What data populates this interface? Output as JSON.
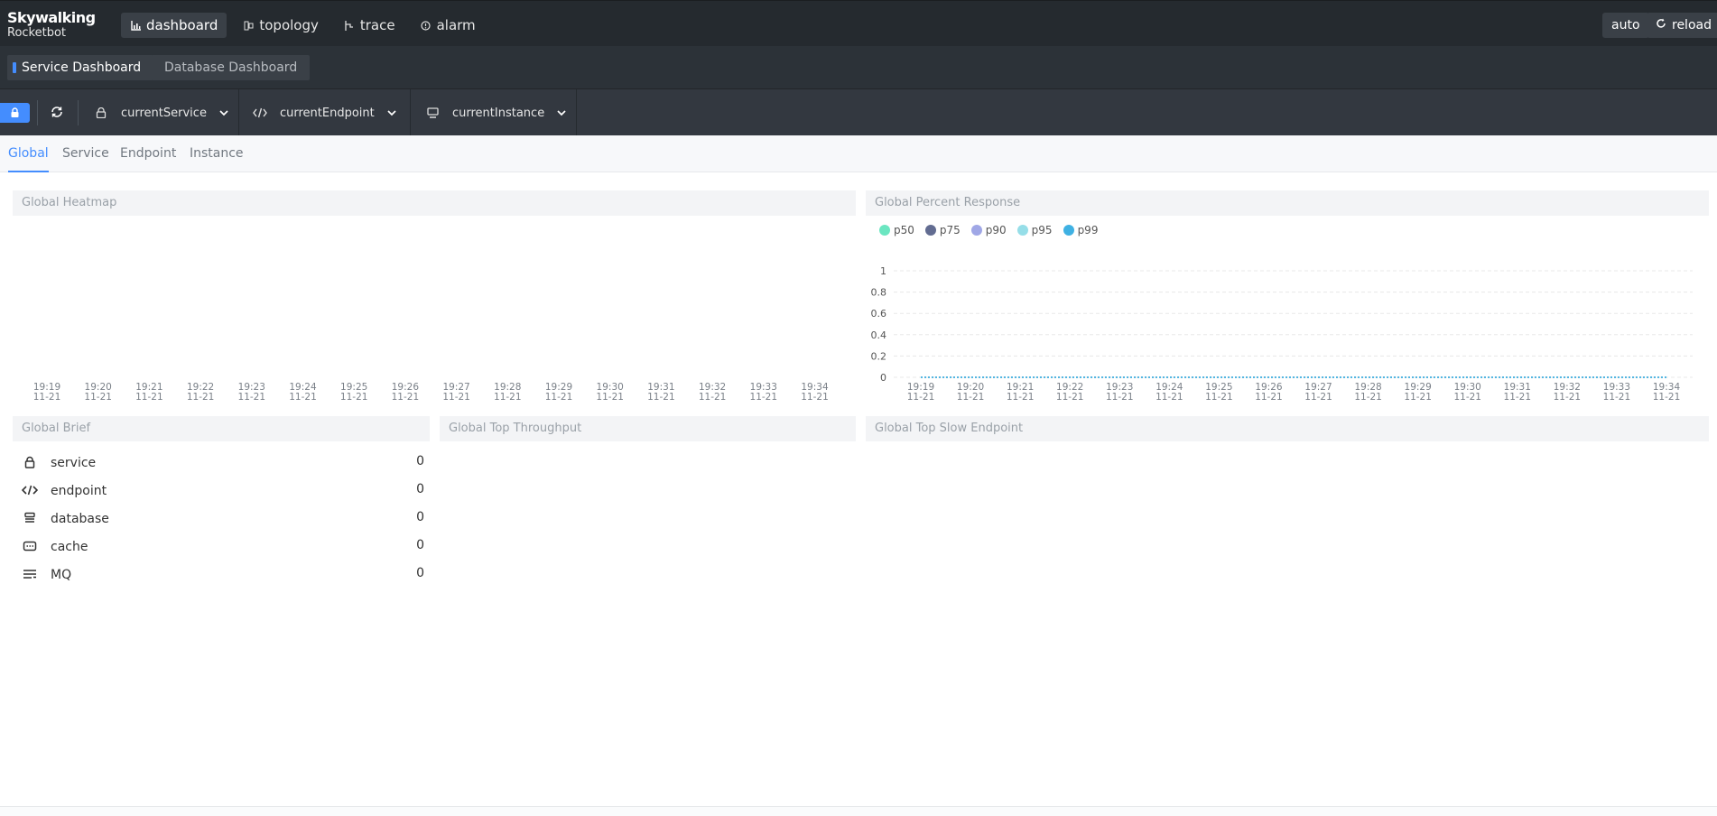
{
  "logo": {
    "line1": "Skywalking",
    "line2": "Rocketbot"
  },
  "nav": {
    "items": [
      {
        "label": "dashboard",
        "icon": "chart-icon",
        "active": true
      },
      {
        "label": "topology",
        "icon": "topology-icon",
        "active": false
      },
      {
        "label": "trace",
        "icon": "trace-icon",
        "active": false
      },
      {
        "label": "alarm",
        "icon": "alarm-icon",
        "active": false
      }
    ],
    "auto_label": "auto",
    "reload_label": "reload"
  },
  "dashboards": [
    {
      "label": "Service Dashboard",
      "active": true
    },
    {
      "label": "Database Dashboard",
      "active": false
    }
  ],
  "toolbar": {
    "service": "currentService",
    "endpoint": "currentEndpoint",
    "instance": "currentInstance"
  },
  "tabs": [
    {
      "label": "Global",
      "active": true
    },
    {
      "label": "Service",
      "active": false
    },
    {
      "label": "Endpoint",
      "active": false
    },
    {
      "label": "Instance",
      "active": false
    }
  ],
  "panels": {
    "heatmap_title": "Global Heatmap",
    "percent_title": "Global Percent Response",
    "brief_title": "Global Brief",
    "throughput_title": "Global Top Throughput",
    "slow_title": "Global Top Slow Endpoint"
  },
  "brief": [
    {
      "label": "service",
      "value": "0",
      "icon": "service-icon"
    },
    {
      "label": "endpoint",
      "value": "0",
      "icon": "endpoint-icon"
    },
    {
      "label": "database",
      "value": "0",
      "icon": "database-icon"
    },
    {
      "label": "cache",
      "value": "0",
      "icon": "cache-icon"
    },
    {
      "label": "MQ",
      "value": "0",
      "icon": "mq-icon"
    }
  ],
  "colors": {
    "accent": "#448dfe",
    "nav_bg": "#252a2f",
    "bar_bg": "#2c3238",
    "toolbar_bg": "#333840"
  },
  "chart_data": [
    {
      "type": "heatmap",
      "title": "Global Heatmap",
      "x": [
        "19:19\n11-21",
        "19:20\n11-21",
        "19:21\n11-21",
        "19:22\n11-21",
        "19:23\n11-21",
        "19:24\n11-21",
        "19:25\n11-21",
        "19:26\n11-21",
        "19:27\n11-21",
        "19:28\n11-21",
        "19:29\n11-21",
        "19:30\n11-21",
        "19:31\n11-21",
        "19:32\n11-21",
        "19:33\n11-21",
        "19:34\n11-21"
      ],
      "x_ticks": [
        {
          "time": "19:19",
          "date": "11-21"
        },
        {
          "time": "19:20",
          "date": "11-21"
        },
        {
          "time": "19:21",
          "date": "11-21"
        },
        {
          "time": "19:22",
          "date": "11-21"
        },
        {
          "time": "19:23",
          "date": "11-21"
        },
        {
          "time": "19:24",
          "date": "11-21"
        },
        {
          "time": "19:25",
          "date": "11-21"
        },
        {
          "time": "19:26",
          "date": "11-21"
        },
        {
          "time": "19:27",
          "date": "11-21"
        },
        {
          "time": "19:28",
          "date": "11-21"
        },
        {
          "time": "19:29",
          "date": "11-21"
        },
        {
          "time": "19:30",
          "date": "11-21"
        },
        {
          "time": "19:31",
          "date": "11-21"
        },
        {
          "time": "19:32",
          "date": "11-21"
        },
        {
          "time": "19:33",
          "date": "11-21"
        },
        {
          "time": "19:34",
          "date": "11-21"
        }
      ],
      "values": []
    },
    {
      "type": "line",
      "title": "Global Percent Response",
      "x_ticks": [
        {
          "time": "19:19",
          "date": "11-21"
        },
        {
          "time": "19:20",
          "date": "11-21"
        },
        {
          "time": "19:21",
          "date": "11-21"
        },
        {
          "time": "19:22",
          "date": "11-21"
        },
        {
          "time": "19:23",
          "date": "11-21"
        },
        {
          "time": "19:24",
          "date": "11-21"
        },
        {
          "time": "19:25",
          "date": "11-21"
        },
        {
          "time": "19:26",
          "date": "11-21"
        },
        {
          "time": "19:27",
          "date": "11-21"
        },
        {
          "time": "19:28",
          "date": "11-21"
        },
        {
          "time": "19:29",
          "date": "11-21"
        },
        {
          "time": "19:30",
          "date": "11-21"
        },
        {
          "time": "19:31",
          "date": "11-21"
        },
        {
          "time": "19:32",
          "date": "11-21"
        },
        {
          "time": "19:33",
          "date": "11-21"
        },
        {
          "time": "19:34",
          "date": "11-21"
        }
      ],
      "y_ticks": [
        "0",
        "0.2",
        "0.4",
        "0.6",
        "0.8",
        "1"
      ],
      "ylim": [
        0,
        1
      ],
      "legend": "top-left",
      "grid": true,
      "series": [
        {
          "name": "p50",
          "color": "#6be6c1",
          "values": [
            0,
            0,
            0,
            0,
            0,
            0,
            0,
            0,
            0,
            0,
            0,
            0,
            0,
            0,
            0,
            0
          ]
        },
        {
          "name": "p75",
          "color": "#626c91",
          "values": [
            0,
            0,
            0,
            0,
            0,
            0,
            0,
            0,
            0,
            0,
            0,
            0,
            0,
            0,
            0,
            0
          ]
        },
        {
          "name": "p90",
          "color": "#a0a7e6",
          "values": [
            0,
            0,
            0,
            0,
            0,
            0,
            0,
            0,
            0,
            0,
            0,
            0,
            0,
            0,
            0,
            0
          ]
        },
        {
          "name": "p95",
          "color": "#96dee8",
          "values": [
            0,
            0,
            0,
            0,
            0,
            0,
            0,
            0,
            0,
            0,
            0,
            0,
            0,
            0,
            0,
            0
          ]
        },
        {
          "name": "p99",
          "color": "#3fb1e3",
          "values": [
            0,
            0,
            0,
            0,
            0,
            0,
            0,
            0,
            0,
            0,
            0,
            0,
            0,
            0,
            0,
            0
          ]
        }
      ]
    }
  ]
}
